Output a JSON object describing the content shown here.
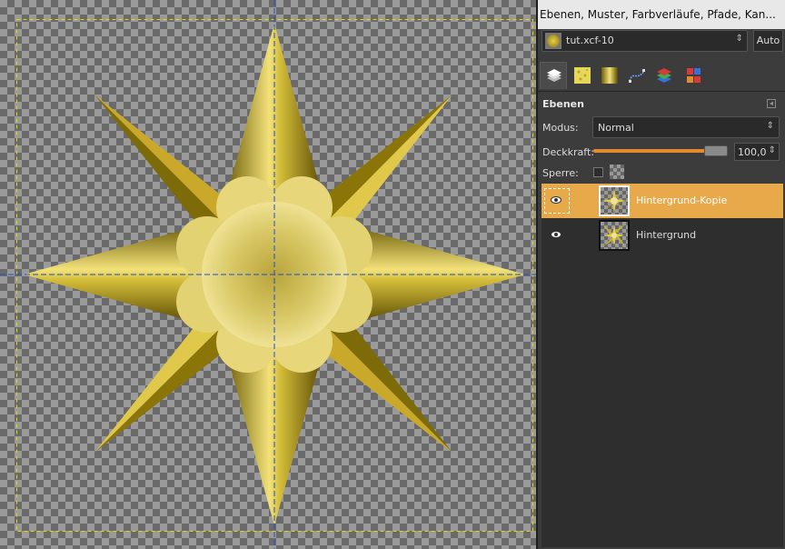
{
  "dock": {
    "title": "Ebenen, Muster, Farbverläufe, Pfade, Kan...",
    "image_name": "tut.xcf-10",
    "auto_label": "Auto",
    "tab_icons": [
      "layers-tab-icon",
      "patterns-tab-icon",
      "gradients-tab-icon",
      "paths-tab-icon",
      "channels-tab-icon",
      "colors-tab-icon"
    ]
  },
  "layers_panel": {
    "heading": "Ebenen",
    "mode_label": "Modus:",
    "mode_value": "Normal",
    "opacity_label": "Deckkraft:",
    "opacity_value": "100,0",
    "opacity_fraction": 1.0,
    "lock_label": "Sperre:",
    "layers": [
      {
        "name": "Hintergrund-Kopie",
        "visible": true,
        "selected": true
      },
      {
        "name": "Hintergrund",
        "visible": true,
        "selected": false
      }
    ]
  },
  "colors": {
    "accent": "#e68a2e",
    "selection": "#e8a94a",
    "gold_light": "#f5e67a",
    "gold_dark": "#7a6a0a",
    "guide": "#1a4fd6"
  }
}
